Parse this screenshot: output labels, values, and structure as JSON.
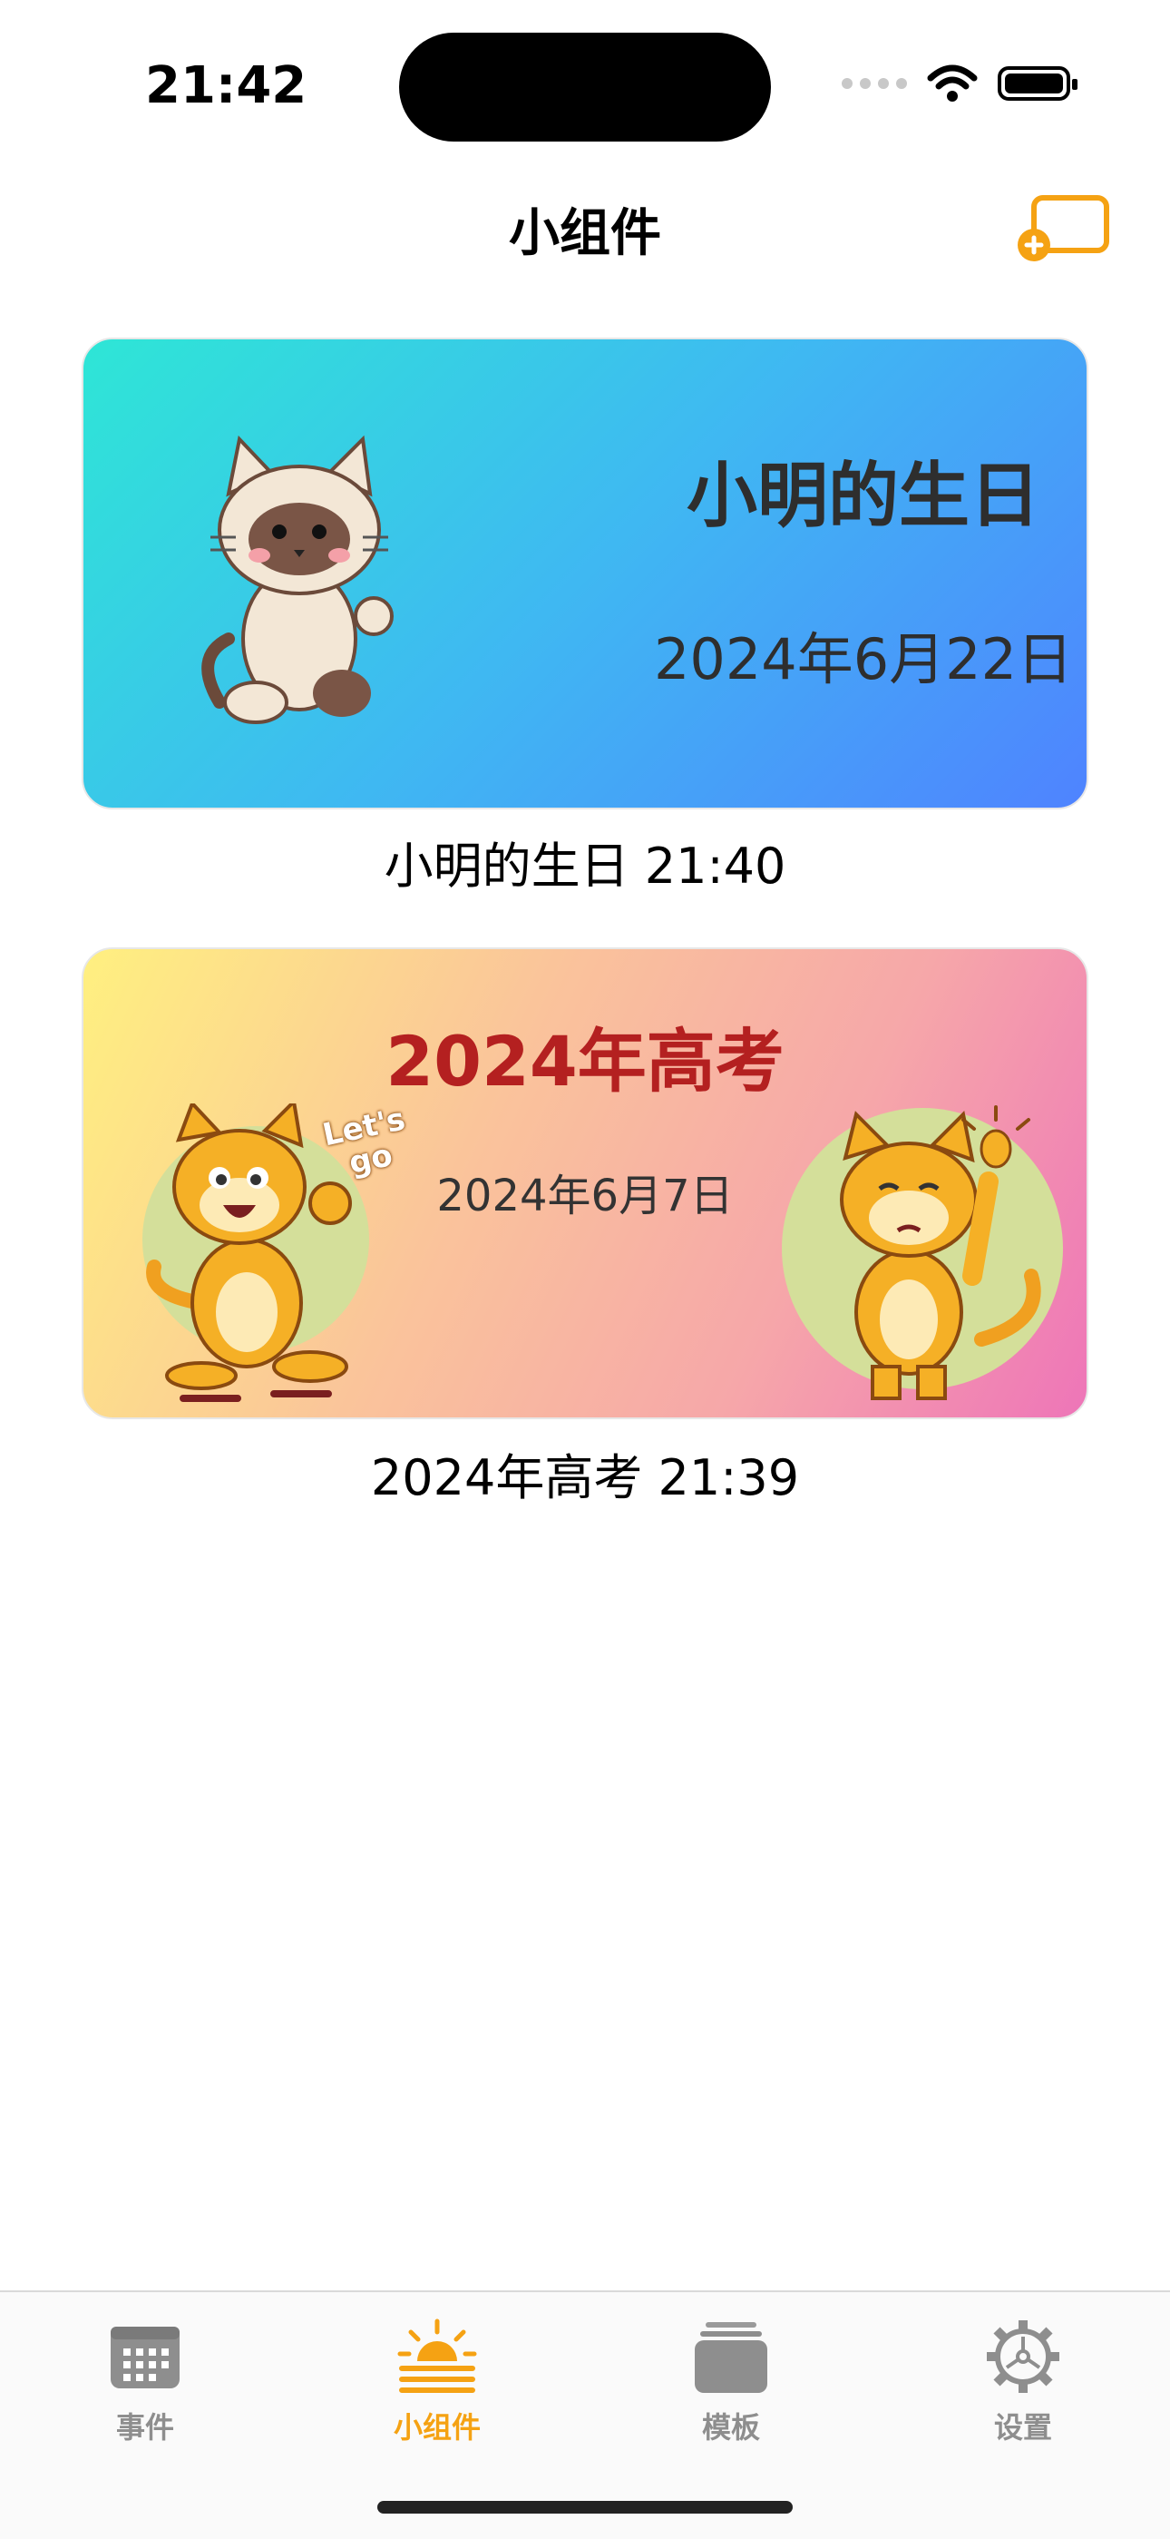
{
  "status_bar": {
    "time": "21:42"
  },
  "nav": {
    "title": "小组件",
    "add_icon": "add-widget-icon"
  },
  "widgets": [
    {
      "title": "小明的生日",
      "date": "2024年6月22日",
      "caption": "小明的生日 21:40",
      "gradient": [
        "#2ee6d6",
        "#4f83ff"
      ],
      "character": "siamese-cat-walking"
    },
    {
      "title": "2024年高考",
      "date": "2024年6月7日",
      "caption": "2024年高考 21:39",
      "gradient": [
        "#fff080",
        "#ee75b8"
      ],
      "sticker_text": "Let's go",
      "characters": [
        "orange-cat-lets-go",
        "orange-cat-idea"
      ]
    }
  ],
  "tabs": [
    {
      "label": "事件",
      "icon": "calendar-icon",
      "active": false
    },
    {
      "label": "小组件",
      "icon": "sunrise-icon",
      "active": true
    },
    {
      "label": "模板",
      "icon": "stack-icon",
      "active": false
    },
    {
      "label": "设置",
      "icon": "gear-icon",
      "active": false
    }
  ],
  "colors": {
    "accent": "#f5a213",
    "inactive": "#8e8e8e",
    "card2_title": "#b42020"
  }
}
